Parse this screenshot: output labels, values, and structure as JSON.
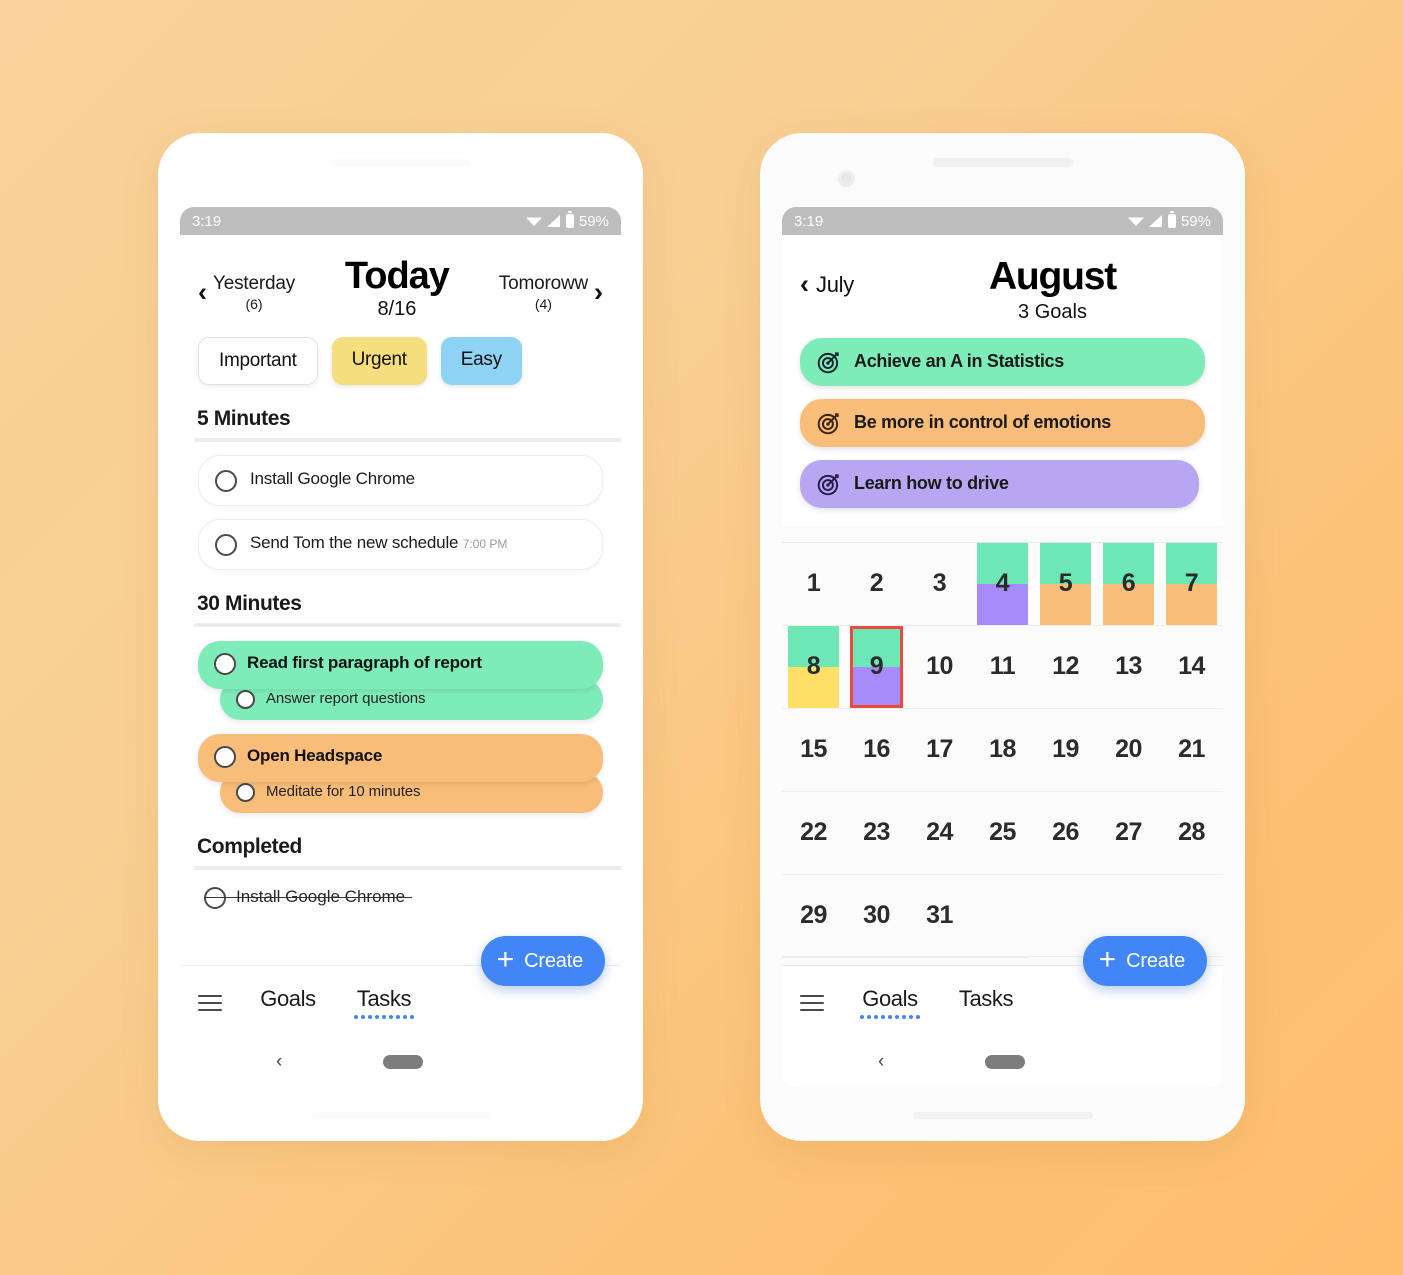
{
  "statusbar": {
    "time": "3:19",
    "battery": "59%"
  },
  "phone1": {
    "header": {
      "prev_label": "Yesterday",
      "prev_count": "(6)",
      "title": "Today",
      "date": "8/16",
      "next_label": "Tomoroww",
      "next_count": "(4)"
    },
    "chips": [
      {
        "label": "Important",
        "style": "white"
      },
      {
        "label": "Urgent",
        "style": "yellow"
      },
      {
        "label": "Easy",
        "style": "blue"
      }
    ],
    "sections": [
      {
        "title": "5 Minutes",
        "tasks": [
          {
            "title": "Install Google Chrome",
            "time": ""
          },
          {
            "title": "Send Tom the new schedule",
            "time": "7:00 PM"
          }
        ]
      },
      {
        "title": "30 Minutes",
        "groups": [
          {
            "parent": "Read first paragraph of report",
            "child": "Answer report questions",
            "color": "#7eecb9"
          },
          {
            "parent": "Open Headspace",
            "child": "Meditate for 10 minutes",
            "color": "#f8bd79"
          }
        ]
      }
    ],
    "completed": {
      "title": "Completed",
      "items": [
        "Install Google Chrome"
      ]
    },
    "nav": {
      "tabs": [
        {
          "label": "Goals",
          "active": false
        },
        {
          "label": "Tasks",
          "active": true
        }
      ],
      "create_label": "Create"
    }
  },
  "phone2": {
    "header": {
      "prev_label": "July",
      "title": "August",
      "subtitle": "3 Goals"
    },
    "goals": [
      {
        "label": "Achieve an A in Statistics",
        "color": "#7eecb9"
      },
      {
        "label": "Be more in control of emotions",
        "color": "#f8bd79"
      },
      {
        "label": "Learn how to drive",
        "color": "#b9a6f2"
      }
    ],
    "calendar": {
      "weeks": [
        [
          {
            "day": "1"
          },
          {
            "day": "2"
          },
          {
            "day": "3"
          },
          {
            "day": "4",
            "top": "#6ee7b7",
            "bottom": "#a78bfa"
          },
          {
            "day": "5",
            "top": "#6ee7b7",
            "bottom": "#f8bd79"
          },
          {
            "day": "6",
            "top": "#6ee7b7",
            "bottom": "#f8bd79"
          },
          {
            "day": "7",
            "top": "#6ee7b7",
            "bottom": "#f8bd79"
          }
        ],
        [
          {
            "day": "8",
            "top": "#6ee7b7",
            "bottom": "#ffe066"
          },
          {
            "day": "9",
            "top": "#6ee7b7",
            "bottom": "#a78bfa",
            "today": true
          },
          {
            "day": "10"
          },
          {
            "day": "11"
          },
          {
            "day": "12"
          },
          {
            "day": "13"
          },
          {
            "day": "14"
          }
        ],
        [
          {
            "day": "15"
          },
          {
            "day": "16"
          },
          {
            "day": "17"
          },
          {
            "day": "18"
          },
          {
            "day": "19"
          },
          {
            "day": "20"
          },
          {
            "day": "21"
          }
        ],
        [
          {
            "day": "22"
          },
          {
            "day": "23"
          },
          {
            "day": "24"
          },
          {
            "day": "25"
          },
          {
            "day": "26"
          },
          {
            "day": "27"
          },
          {
            "day": "28"
          }
        ],
        [
          {
            "day": "29"
          },
          {
            "day": "30"
          },
          {
            "day": "31"
          },
          {
            "day": ""
          },
          {
            "day": ""
          },
          {
            "day": ""
          },
          {
            "day": ""
          }
        ]
      ]
    },
    "nav": {
      "tabs": [
        {
          "label": "Goals",
          "active": true
        },
        {
          "label": "Tasks",
          "active": false
        }
      ],
      "create_label": "Create"
    }
  },
  "colors": {
    "accent_blue": "#4285f4",
    "today_border": "#e74c3c",
    "background": "#f9cf93"
  }
}
